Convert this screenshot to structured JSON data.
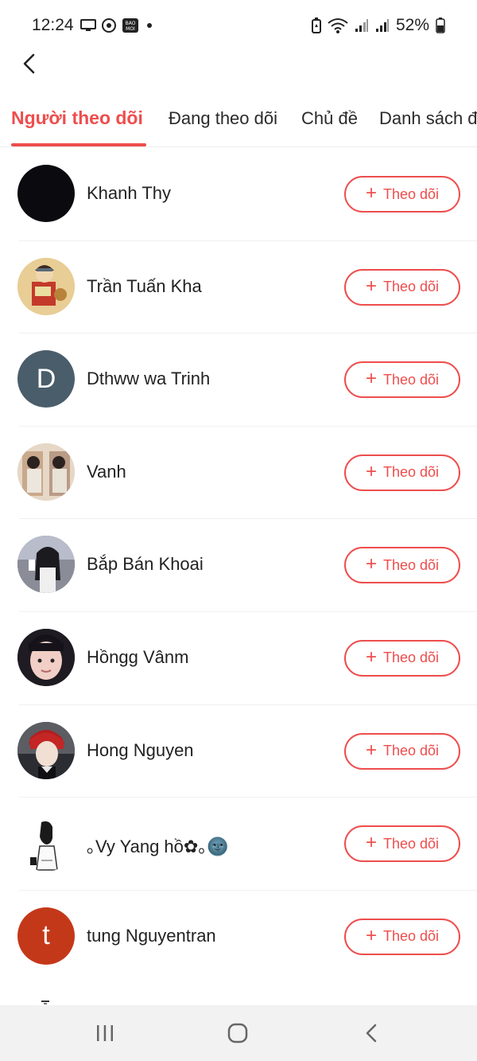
{
  "status_bar": {
    "time": "12:24",
    "battery": "52%",
    "left_icons": [
      "cast-icon",
      "vpn-icon",
      "baomoi-icon",
      "dot-icon"
    ],
    "right_icons": [
      "battery-saver-icon",
      "wifi-icon",
      "signal-icon",
      "signal-icon",
      "battery-icon"
    ]
  },
  "tabs": [
    {
      "label": "Người theo dõi",
      "active": true
    },
    {
      "label": "Đang theo dõi",
      "active": false
    },
    {
      "label": "Chủ đề",
      "active": false
    },
    {
      "label": "Danh sách đ",
      "active": false
    }
  ],
  "follow_label": "Theo dõi",
  "followers": [
    {
      "name": "Khanh Thy",
      "avatar": "black-avatar",
      "color": "#0b0b0f"
    },
    {
      "name": "Trần Tuấn Kha",
      "avatar": "cartoon-avatar",
      "color": "#c9a066"
    },
    {
      "name": "Dthww wa Trinh",
      "avatar": "letter-avatar",
      "letter": "D",
      "color": "#4a5d6b"
    },
    {
      "name": "Vanh",
      "avatar": "photo-avatar",
      "color": "#b89a82"
    },
    {
      "name": "Bắp Bán Khoai",
      "avatar": "photo-avatar",
      "color": "#3b3b44"
    },
    {
      "name": "Hồngg Vânm",
      "avatar": "photo-avatar",
      "color": "#2e2a30"
    },
    {
      "name": "Hong Nguyen",
      "avatar": "anime-avatar",
      "color": "#7a1d1d"
    },
    {
      "name": "｡Vy Yang hồ✿｡🌚",
      "avatar": "sketch-avatar",
      "color": "#ffffff"
    },
    {
      "name": "tung Nguyentran",
      "avatar": "letter-avatar",
      "letter": "t",
      "color": "#c4381a"
    }
  ],
  "colors": {
    "accent": "#ee4d4d",
    "nav_background": "#f2f2f2"
  },
  "navbar": [
    "recents-icon",
    "home-icon",
    "back-icon"
  ]
}
